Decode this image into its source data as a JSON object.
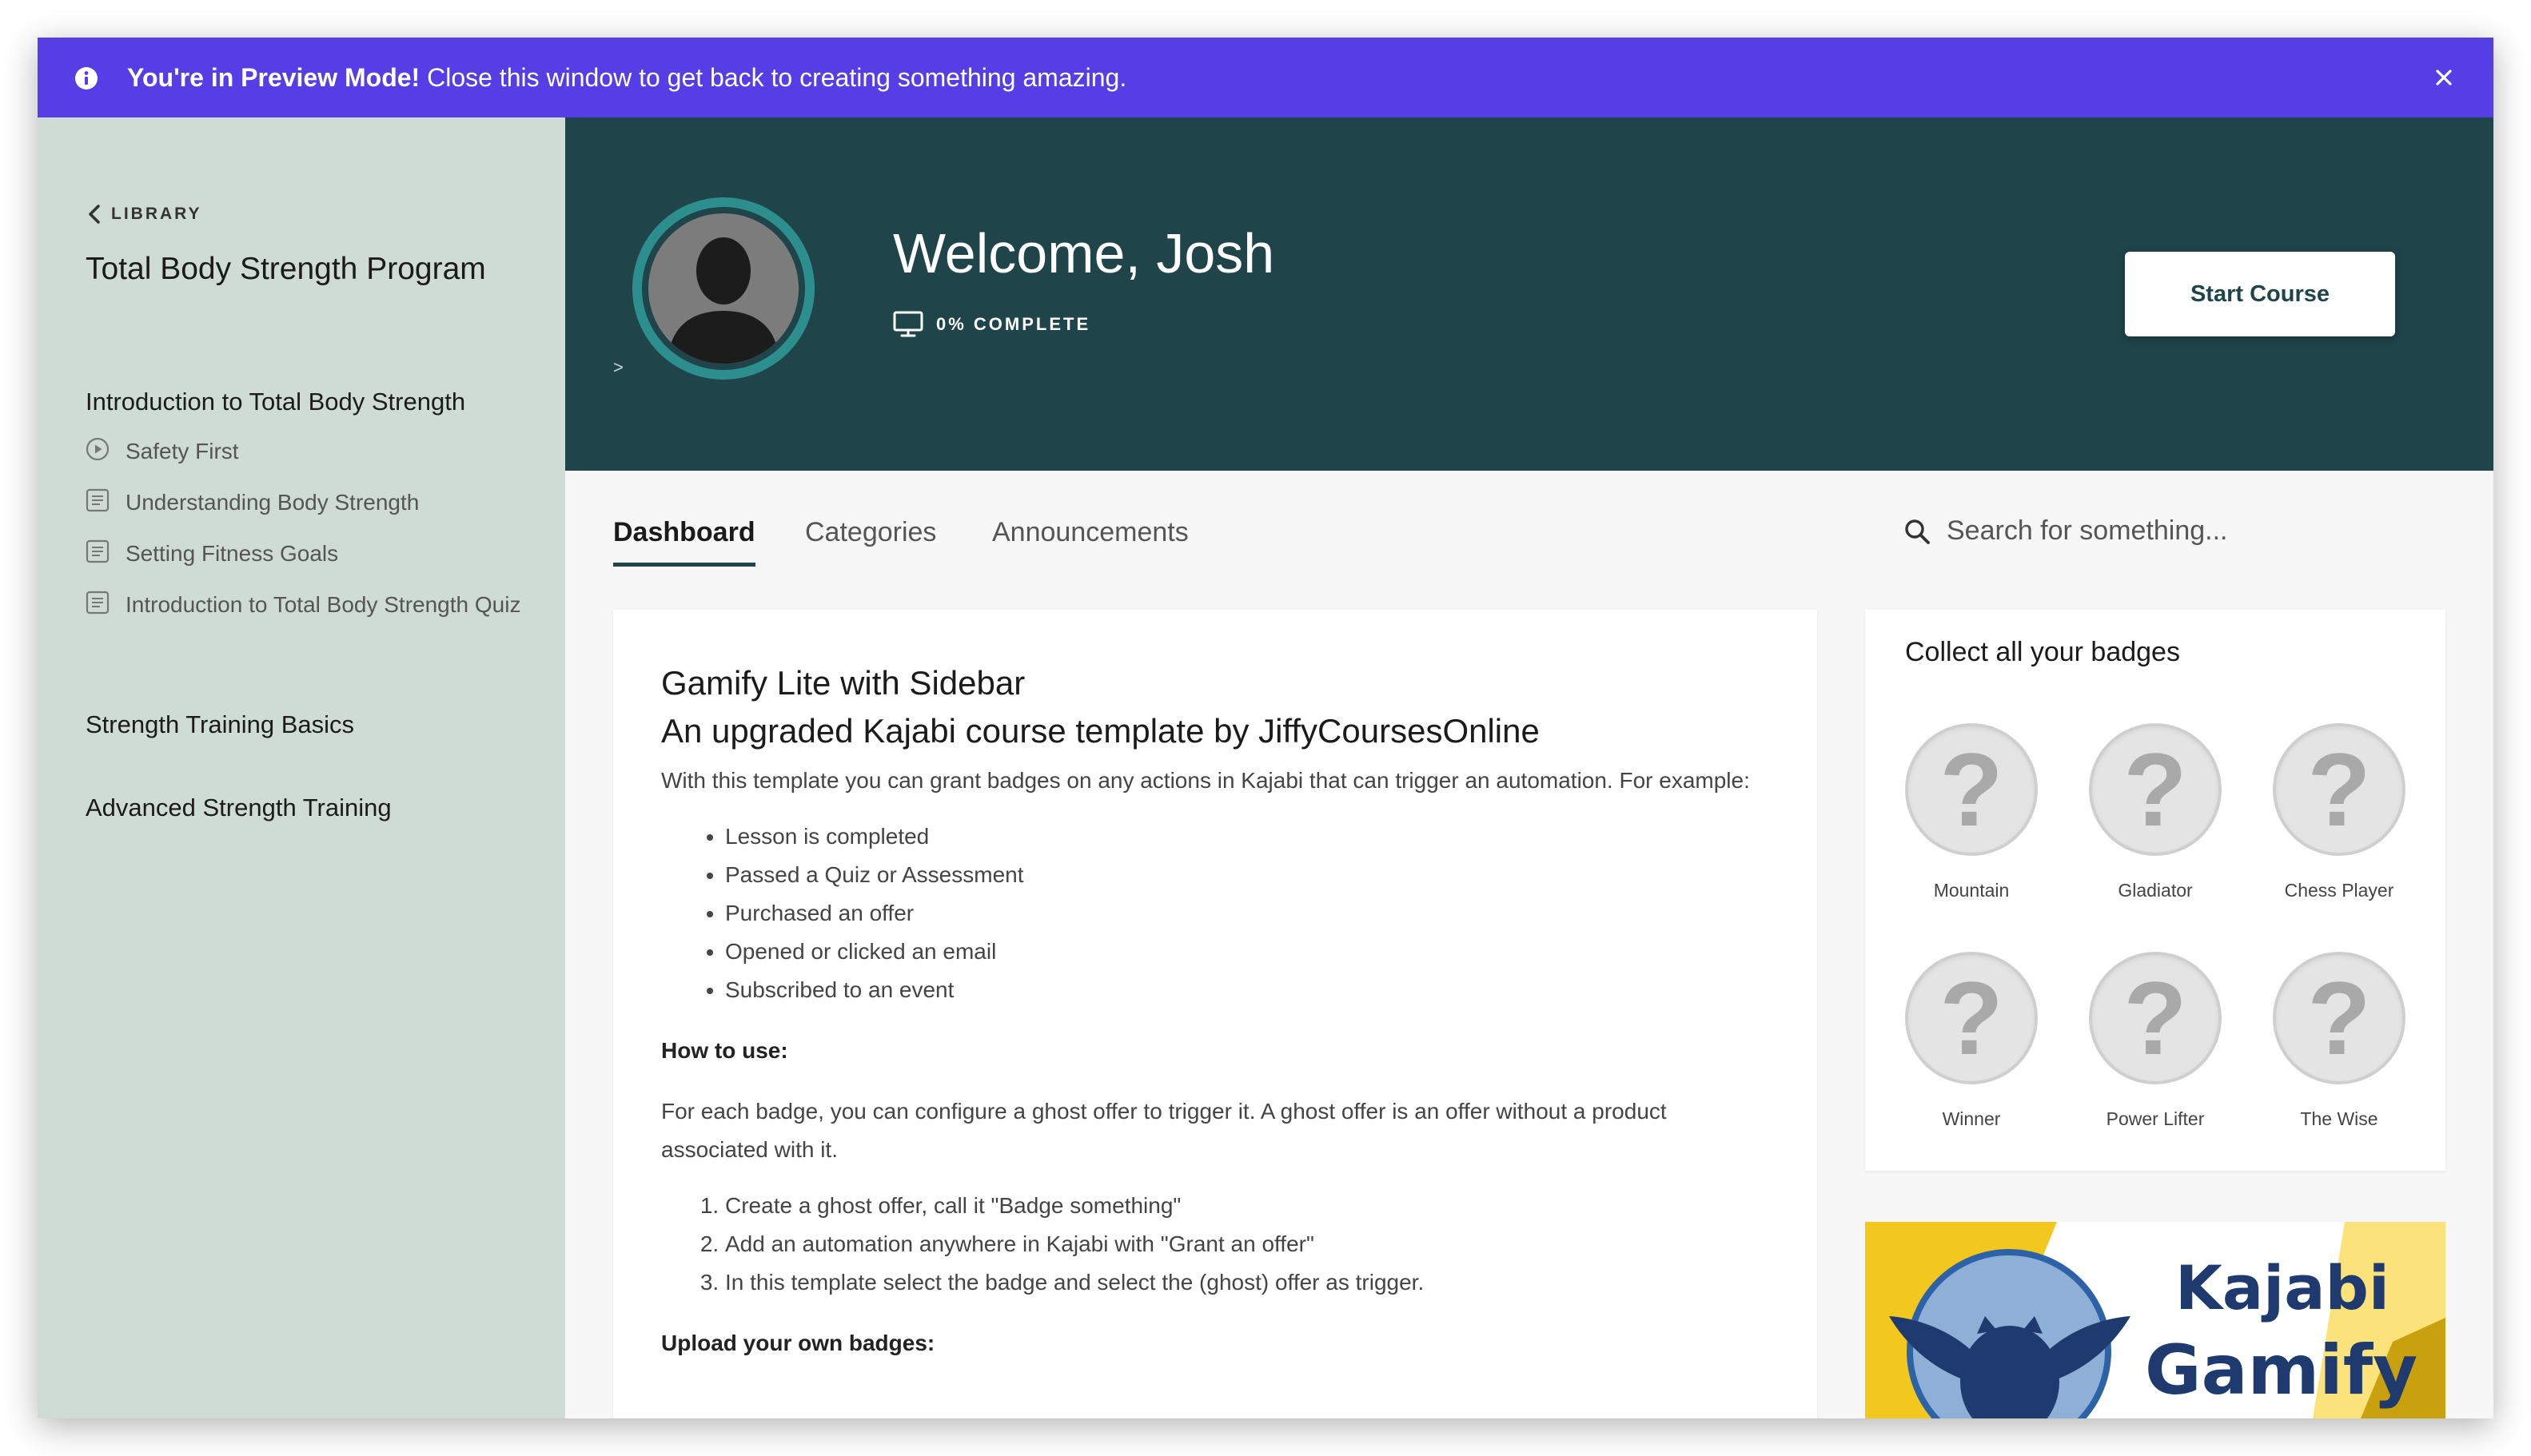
{
  "banner": {
    "bold_text": "You're in Preview Mode!",
    "text": " Close this window to get back to creating something amazing."
  },
  "sidebar": {
    "back_label": "LIBRARY",
    "program_title": "Total Body Strength Program",
    "sections": [
      {
        "title": "Introduction to Total Body Strength",
        "lessons": [
          {
            "label": "Safety First",
            "icon": "play-circle-icon"
          },
          {
            "label": "Understanding Body Strength",
            "icon": "document-icon"
          },
          {
            "label": "Setting Fitness Goals",
            "icon": "document-icon"
          },
          {
            "label": "Introduction to Total Body Strength Quiz",
            "icon": "document-icon"
          }
        ]
      },
      {
        "title": "Strength Training Basics",
        "lessons": []
      },
      {
        "title": "Advanced Strength Training",
        "lessons": []
      }
    ]
  },
  "header": {
    "caret": ">",
    "welcome": "Welcome, Josh",
    "progress_label": "0% COMPLETE",
    "progress_value": 0,
    "start_button": "Start Course"
  },
  "tabs": [
    "Dashboard",
    "Categories",
    "Announcements"
  ],
  "search": {
    "placeholder": "Search for something..."
  },
  "content": {
    "title_line1": "Gamify Lite with Sidebar",
    "title_line2": "An upgraded Kajabi course template by JiffyCoursesOnline",
    "intro": "With this template you can grant badges on any actions in Kajabi that can trigger an automation. For example:",
    "bullets": [
      "Lesson is completed",
      "Passed a Quiz or Assessment",
      "Purchased an offer",
      "Opened or clicked an email",
      "Subscribed to an event"
    ],
    "how_to_heading": "How to use:",
    "how_to_text": "For each badge, you can configure a ghost offer to trigger it. A ghost offer is an offer without a product associated with it.",
    "steps": [
      "Create a ghost offer, call it \"Badge something\"",
      "Add an automation anywhere in Kajabi with \"Grant an offer\"",
      "In this template select the badge and select the (ghost) offer as trigger."
    ],
    "upload_heading": "Upload your own badges:"
  },
  "badges": {
    "title": "Collect all your badges",
    "symbol": "?",
    "items": [
      "Mountain",
      "Gladiator",
      "Chess Player",
      "Winner",
      "Power Lifter",
      "The Wise"
    ]
  },
  "promo": {
    "line1": "Kajabi",
    "line2": "Gamify"
  },
  "colors": {
    "banner": "#563ee6",
    "sidebar": "#cfdcd6",
    "header": "#1f4449",
    "avatar_ring": "#2c8f8e",
    "promo_yellow": "#f2c81f",
    "promo_navy": "#1e3a6e"
  }
}
